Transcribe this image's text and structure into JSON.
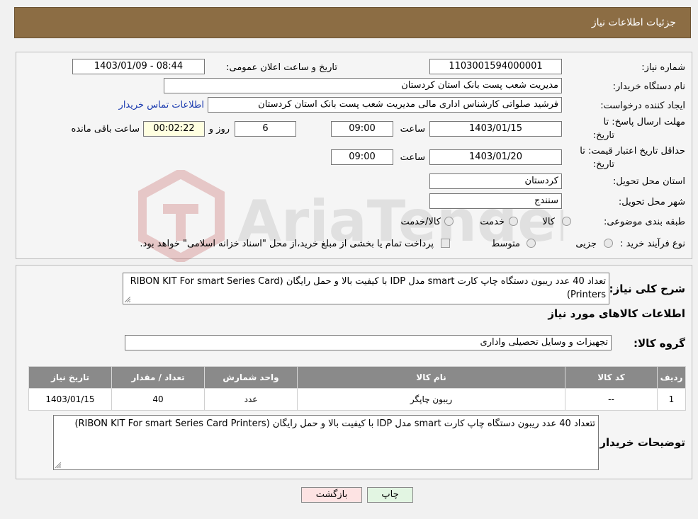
{
  "header": {
    "title": "جزئیات اطلاعات نیاز"
  },
  "form": {
    "need_number_label": "شماره نیاز:",
    "need_number": "1103001594000001",
    "announce_label": "تاریخ و ساعت اعلان عمومی:",
    "announce_value": "1403/01/09 - 08:44",
    "buyer_org_label": "نام دستگاه خریدار:",
    "buyer_org": "مدیریت شعب پست بانک استان کردستان",
    "creator_label": "ایجاد کننده درخواست:",
    "creator": "فرشید صلواتی کارشناس اداری مالی مدیریت شعب پست بانک استان کردستان",
    "contact_link": "اطلاعات تماس خریدار",
    "deadline_label_1": "مهلت ارسال پاسخ: تا",
    "deadline_label_2": "تاریخ:",
    "deadline_date": "1403/01/15",
    "time_label": "ساعت",
    "deadline_time": "09:00",
    "days_value": "6",
    "days_label": "روز و",
    "remaining_time": "00:02:22",
    "remaining_label": "ساعت باقی مانده",
    "validity_label_1": "حداقل تاریخ اعتبار قیمت: تا",
    "validity_label_2": "تاریخ:",
    "validity_date": "1403/01/20",
    "validity_time": "09:00",
    "province_label": "استان محل تحویل:",
    "province": "کردستان",
    "city_label": "شهر محل تحویل:",
    "city": "سنندج",
    "category_label": "طبقه بندی موضوعی:",
    "category_options": [
      "کالا",
      "خدمت",
      "کالا/خدمت"
    ],
    "process_label": "نوع فرآیند خرید :",
    "process_options": [
      "جزیی",
      "متوسط"
    ],
    "payment_note": "پرداخت تمام یا بخشی از مبلغ خرید،از محل \"اسناد خزانه اسلامی\" خواهد بود."
  },
  "details": {
    "summary_label": "شرح کلی نیاز:",
    "summary": "تعداد 40 عدد ریبون دستگاه چاپ کارت smart   مدل IDP با کیفیت بالا و حمل رایگان (RIBON KIT For smart Series Card Printers)",
    "goods_info_title": "اطلاعات کالاهای مورد نیاز",
    "goods_group_label": "گروه کالا:",
    "goods_group": "تجهیزات و وسایل تحصیلی واداری",
    "table": {
      "headers": [
        "ردیف",
        "کد کالا",
        "نام کالا",
        "واحد شمارش",
        "تعداد / مقدار",
        "تاریخ نیاز"
      ],
      "rows": [
        [
          "1",
          "--",
          "ریبون چاپگر",
          "عدد",
          "40",
          "1403/01/15"
        ]
      ]
    },
    "buyer_notes_label": "توضیحات خریدار:",
    "buyer_notes": "تتعداد 40 عدد ریبون دستگاه چاپ کارت smart   مدل IDP با کیفیت بالا و حمل رایگان (RIBON KIT For smart Series Card Printers)"
  },
  "buttons": {
    "print": "چاپ",
    "back": "بازگشت"
  },
  "watermark": "AriaTender.net"
}
